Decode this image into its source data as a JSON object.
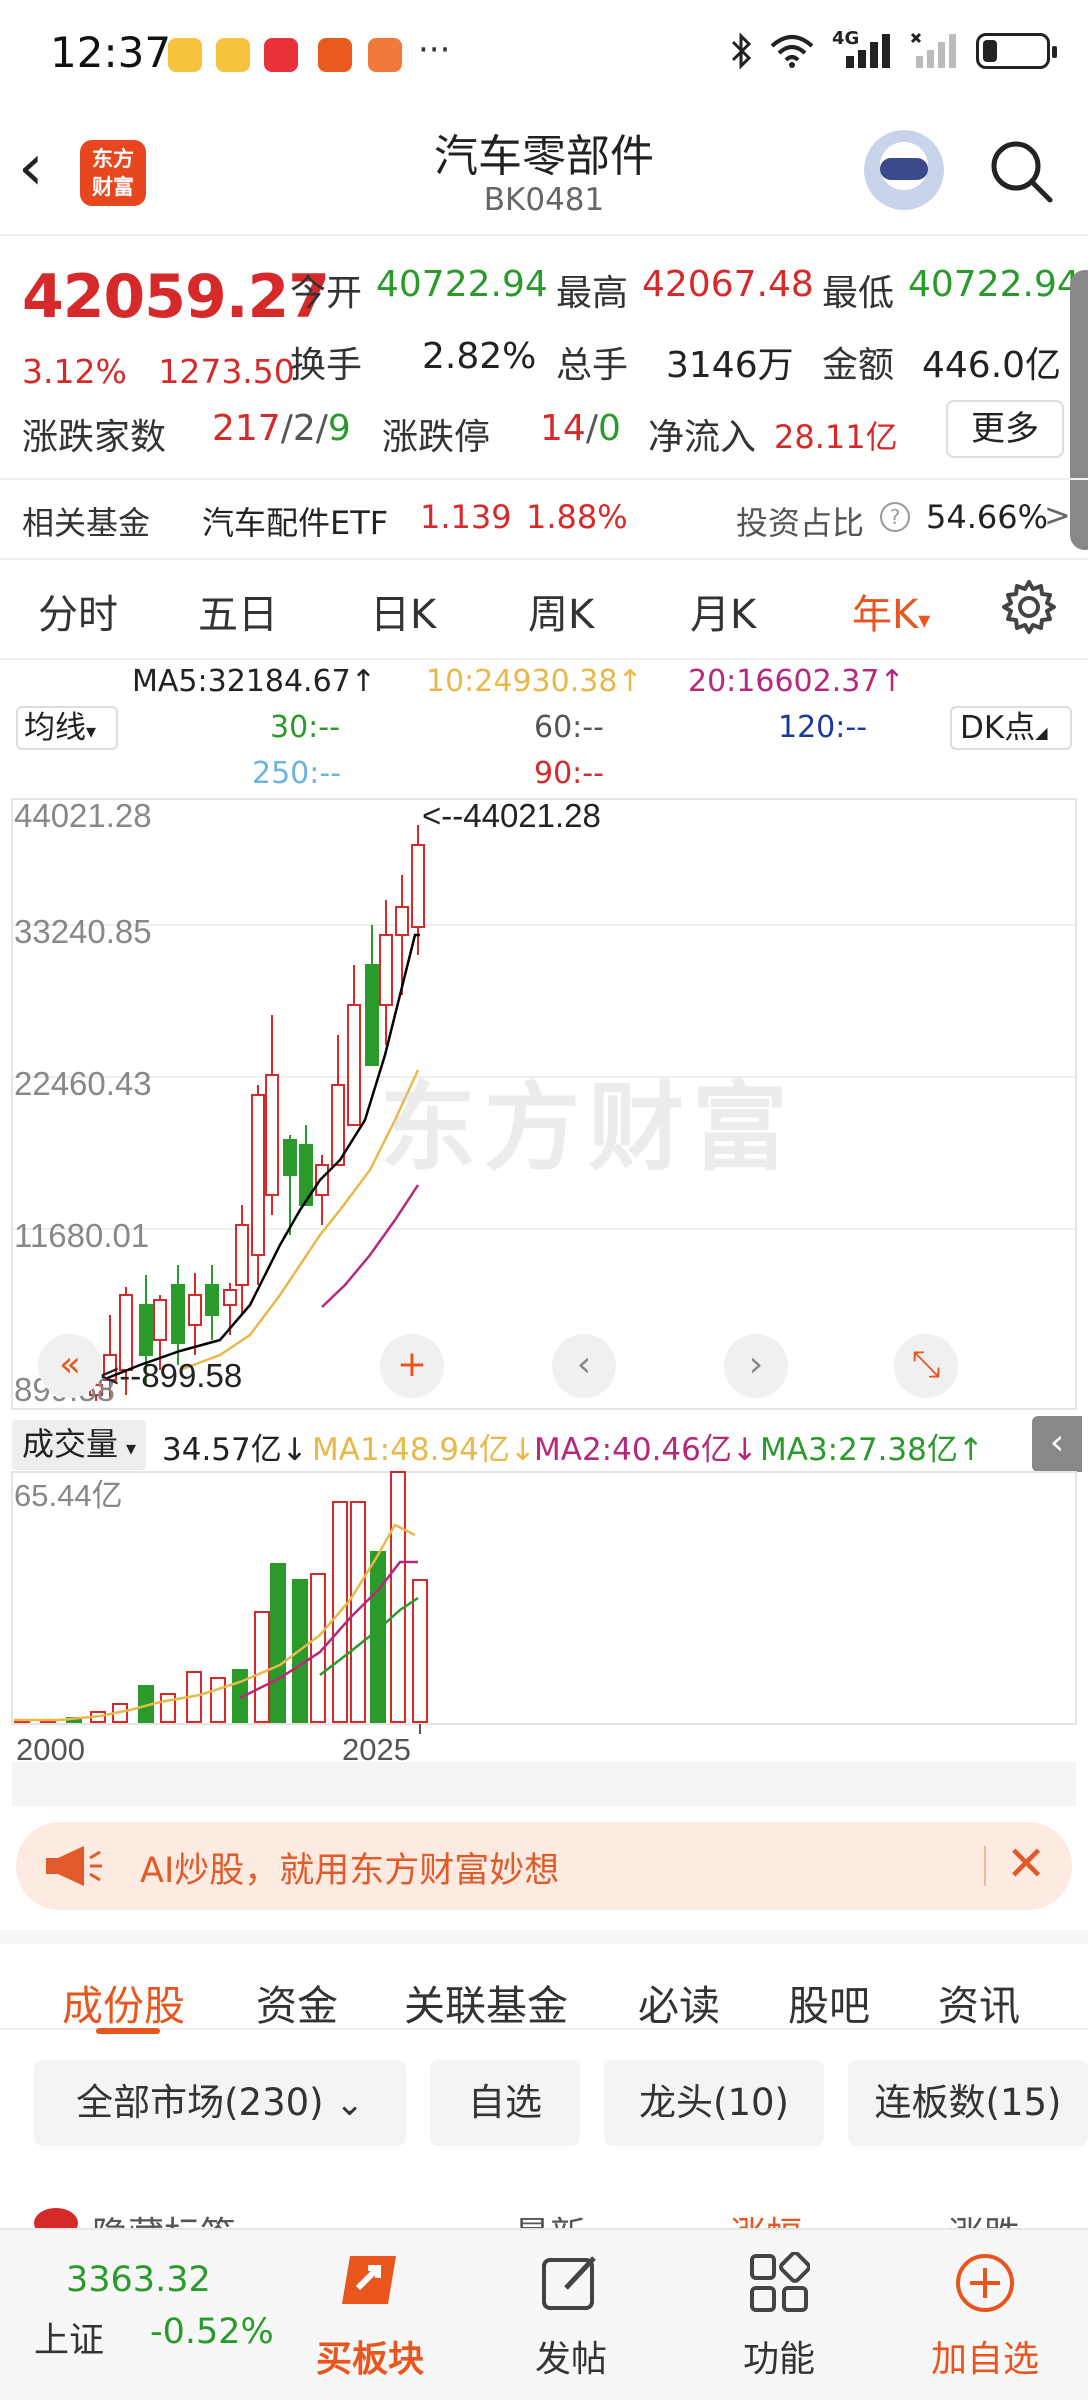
{
  "status_bar": {
    "time": "12:37",
    "icons": [
      "weibo-icon",
      "weibo-icon",
      "xiaohongshu-icon",
      "app-icon",
      "app-icon"
    ],
    "more": "···",
    "network": "4G"
  },
  "header": {
    "back": "‹",
    "logo_line1": "东方",
    "logo_line2": "财富",
    "title": "汽车零部件",
    "code": "BK0481"
  },
  "quote": {
    "price": "42059.27",
    "change_pct": "3.12%",
    "change_abs": "1273.50",
    "open_label": "今开",
    "open_value": "40722.94",
    "high_label": "最高",
    "high_value": "42067.48",
    "low_label": "最低",
    "low_value": "40722.94",
    "turnover_label": "换手",
    "turnover_value": "2.82%",
    "volume_label": "总手",
    "volume_value": "3146万",
    "amount_label": "金额",
    "amount_value": "446.0亿",
    "updown_label": "涨跌家数",
    "up_count": "217",
    "slash1": "/",
    "flat_count": "2",
    "slash2": "/",
    "down_count": "9",
    "limit_label": "涨跌停",
    "limit_up": "14",
    "slash3": "/",
    "limit_down": "0",
    "inflow_label": "净流入",
    "inflow_value": "28.11亿",
    "more_label": "更多"
  },
  "fund": {
    "label": "相关基金",
    "name": "汽车配件ETF",
    "price": "1.139",
    "pct": "1.88%",
    "ratio_label": "投资占比",
    "ratio_value": "54.66%",
    "arrow": ">"
  },
  "chart_tabs": [
    "分时",
    "五日",
    "日K",
    "周K",
    "月K",
    "年K"
  ],
  "chart_tab_active_caret": "▾",
  "ma_header": {
    "ma5": "MA5:32184.67↑",
    "ma10": "10:24930.38↑",
    "ma20": "20:16602.37↑",
    "ma30": "30:--",
    "ma60": "60:--",
    "ma120": "120:--",
    "ma250": "250:--",
    "ma90": "90:--",
    "junxian": "均线",
    "junxian_caret": "▾",
    "dk": "DK点",
    "dk_caret": "◢"
  },
  "price_chart": {
    "y_labels": [
      "44021.28",
      "33240.85",
      "22460.43",
      "11680.01",
      "899.58"
    ],
    "max_annotation": "<--44021.28",
    "min_annotation": "<--899.58",
    "watermark": "东方财富",
    "nav": {
      "rewind": "«",
      "zoom_in": "+",
      "prev": "‹",
      "next": "›",
      "expand": "⤡"
    }
  },
  "volume": {
    "select": "成交量",
    "select_caret": "▾",
    "value": "34.57亿↓",
    "ma1": "MA1:48.94亿↓",
    "ma2": "MA2:40.46亿↓",
    "ma3": "MA3:27.38亿↑",
    "y_label": "65.44亿",
    "x_start": "2000",
    "x_end": "2025",
    "collapse": "‹"
  },
  "banner": {
    "text": "AI炒股，就用东方财富妙想",
    "close": "✕"
  },
  "stock_tabs": [
    "成份股",
    "资金",
    "关联基金",
    "必读",
    "股吧",
    "资讯"
  ],
  "filters": [
    "全部市场(230)",
    "自选",
    "龙头(10)",
    "连板数(15)"
  ],
  "filter_caret": "⌄",
  "list_header": [
    "隐藏标签",
    "最新",
    "涨幅",
    "涨跌"
  ],
  "bottom_bar": {
    "index_value": "3363.32",
    "index_name": "上证",
    "index_pct": "-0.52%",
    "buy_label": "买板块",
    "post_label": "发帖",
    "func_label": "功能",
    "add_label": "加自选"
  },
  "colors": {
    "up": "#d62a2a",
    "down": "#2a9a2a",
    "accent": "#e8561e",
    "ma5": "#000000",
    "ma10": "#e8b84a",
    "ma20": "#b8287a",
    "ma120": "#1a3a9a",
    "ma250": "#6cb4e0"
  }
}
